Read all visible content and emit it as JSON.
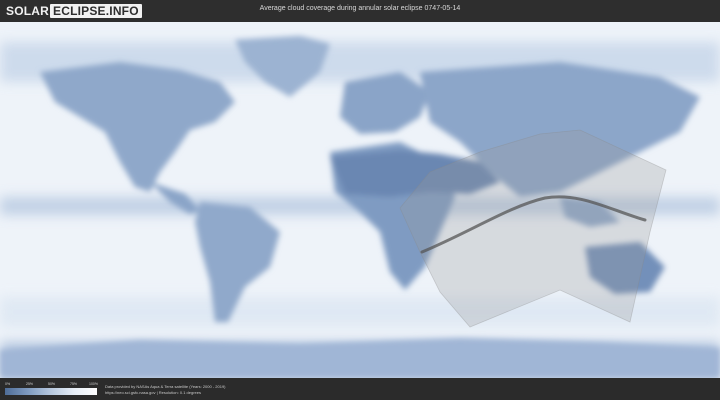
{
  "header": {
    "logo_part1": "SOLAR",
    "logo_part2": "ECLIPSE.INFO",
    "title": "Average cloud coverage during annular solar eclipse 0747-05-14"
  },
  "legend": {
    "tick_labels": [
      "0%",
      "25%",
      "50%",
      "75%",
      "100%"
    ],
    "colors": [
      "#4f6d98",
      "#7f9bc0",
      "#b7c8de",
      "#e7eef7",
      "#ffffff"
    ]
  },
  "credits": {
    "line1": "Data provided by NASAs Aqua & Terra satellite (Years: 2000 - 2019)",
    "line2": "https://neo.sci.gsfc.nasa.gov | Resolution: 0.1 degrees"
  },
  "map": {
    "ocean_color": "#f1f5fa",
    "land_color": "#93abcb",
    "cloudy_band_color": "#c4d4e8",
    "clear_land_color": "#7590b8",
    "eclipse_zone_color": "#9a9a9a",
    "eclipse_path_color": "#555555"
  }
}
